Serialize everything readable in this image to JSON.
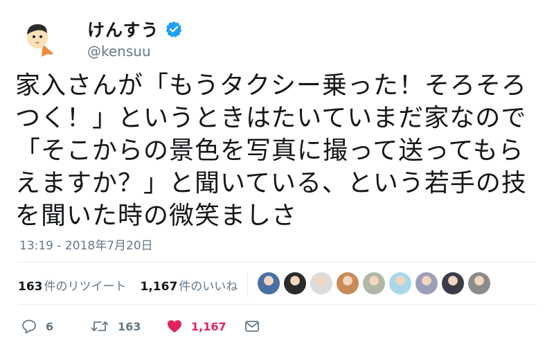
{
  "tweet": {
    "display_name": "けんすう",
    "handle": "@kensuu",
    "text": "家入さんが「もうタクシー乗った！そろそろ\nつく！」というときはたいていまだ家なので\n「そこからの景色を写真に撮って送ってもら\nえますか？」と聞いている、という若手の技\nを聞いた時の微笑ましさ",
    "timestamp": "13:19 - 2018年7月20日"
  },
  "stats": {
    "retweets_count": "163",
    "retweets_label": "件のリツイート",
    "likes_count": "1,167",
    "likes_label": "件のいいね"
  },
  "likers": [
    {
      "icon": "user-avatar-1",
      "color": "#4a6fa5"
    },
    {
      "icon": "user-avatar-2",
      "color": "#2b2b2b"
    },
    {
      "icon": "user-avatar-3",
      "color": "#dcdcdc"
    },
    {
      "icon": "user-avatar-4",
      "color": "#c98a5a"
    },
    {
      "icon": "user-avatar-5",
      "color": "#b0b8a8"
    },
    {
      "icon": "user-avatar-6",
      "color": "#a8d8e8"
    },
    {
      "icon": "user-avatar-7",
      "color": "#9ba0b8"
    },
    {
      "icon": "user-avatar-8",
      "color": "#3c3c48"
    },
    {
      "icon": "user-avatar-9",
      "color": "#8c8c8c"
    }
  ],
  "actions": {
    "reply_count": "6",
    "retweet_count": "163",
    "like_count": "1,167"
  },
  "colors": {
    "verified": "#1da1f2",
    "like_active": "#e0245e",
    "secondary_text": "#657786"
  }
}
